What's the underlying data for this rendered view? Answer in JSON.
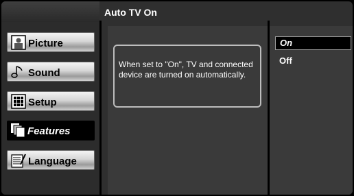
{
  "header": {
    "title": "Auto TV On"
  },
  "sidebar": {
    "items": [
      {
        "label": "Picture",
        "icon": "picture-icon"
      },
      {
        "label": "Sound",
        "icon": "sound-icon"
      },
      {
        "label": "Setup",
        "icon": "setup-icon"
      },
      {
        "label": "Features",
        "icon": "features-icon"
      },
      {
        "label": "Language",
        "icon": "language-icon"
      }
    ],
    "active_item": "Features"
  },
  "description": {
    "text": "When set to \"On\", TV and connected device are turned on automatically."
  },
  "options": {
    "items": [
      {
        "label": "On"
      },
      {
        "label": "Off"
      }
    ],
    "selected": "On"
  }
}
